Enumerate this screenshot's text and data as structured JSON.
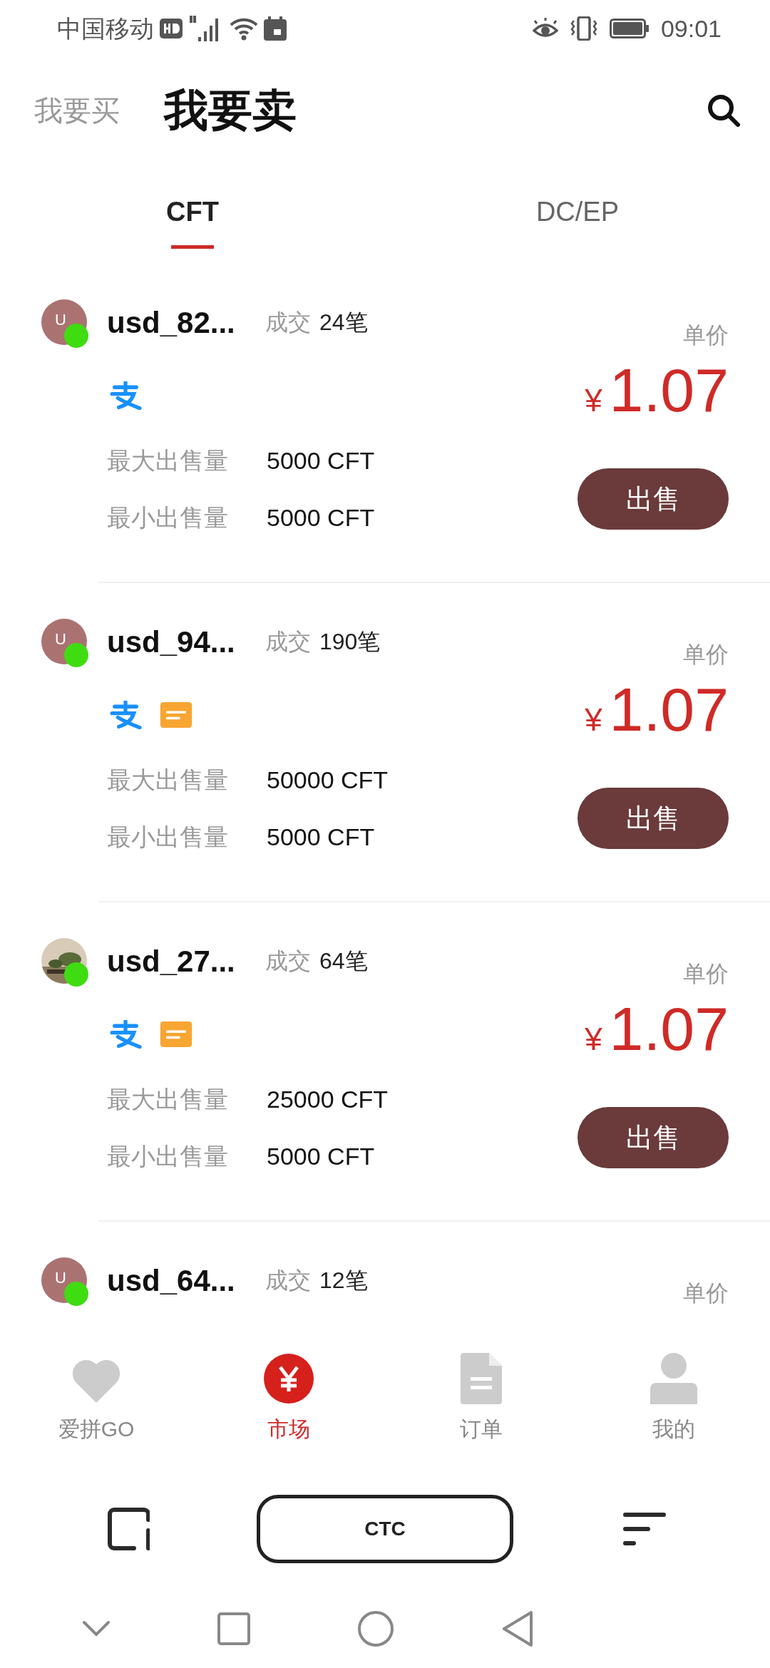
{
  "status_bar": {
    "carrier": "中国移动",
    "time": "09:01"
  },
  "header_tabs": [
    {
      "label": "我要买",
      "selected": false
    },
    {
      "label": "我要卖",
      "selected": true
    }
  ],
  "coin_tabs": [
    {
      "label": "CFT",
      "selected": true
    },
    {
      "label": "DC/EP",
      "selected": false
    }
  ],
  "listings": [
    {
      "avatar": {
        "kind": "letter",
        "letter": "U"
      },
      "online": true,
      "user": "usd_82...",
      "deals_label": "成交",
      "deals": "24笔",
      "payments": [
        {
          "kind": "alipay"
        }
      ],
      "price_label": "单价",
      "currency": "¥",
      "price": "1.07",
      "max_label": "最大出售量",
      "max": "5000 CFT",
      "min_label": "最小出售量",
      "min": "5000 CFT",
      "action": "出售"
    },
    {
      "avatar": {
        "kind": "letter",
        "letter": "U"
      },
      "online": true,
      "user": "usd_94...",
      "deals_label": "成交",
      "deals": "190笔",
      "payments": [
        {
          "kind": "alipay"
        },
        {
          "kind": "card"
        }
      ],
      "price_label": "单价",
      "currency": "¥",
      "price": "1.07",
      "max_label": "最大出售量",
      "max": "50000 CFT",
      "min_label": "最小出售量",
      "min": "5000 CFT",
      "action": "出售"
    },
    {
      "online": true,
      "user": "usd_27...",
      "deals_label": "成交",
      "deals": "64笔",
      "payments": [
        {
          "kind": "alipay"
        },
        {
          "kind": "card"
        }
      ],
      "price_label": "单价",
      "currency": "¥",
      "price": "1.07",
      "max_label": "最大出售量",
      "max": "25000 CFT",
      "min_label": "最小出售量",
      "min": "5000 CFT",
      "action": "出售"
    },
    {
      "avatar": {
        "kind": "letter",
        "letter": "U"
      },
      "online": true,
      "user": "usd_64...",
      "deals_label": "成交",
      "deals": "12笔",
      "price_label": "单价"
    }
  ],
  "bottom_nav": [
    {
      "label": "爱拼GO",
      "selected": false
    },
    {
      "label": "市场",
      "selected": true
    },
    {
      "label": "订单",
      "selected": false
    },
    {
      "label": "我的",
      "selected": false
    }
  ],
  "action_bar": {
    "button": "CTC"
  }
}
